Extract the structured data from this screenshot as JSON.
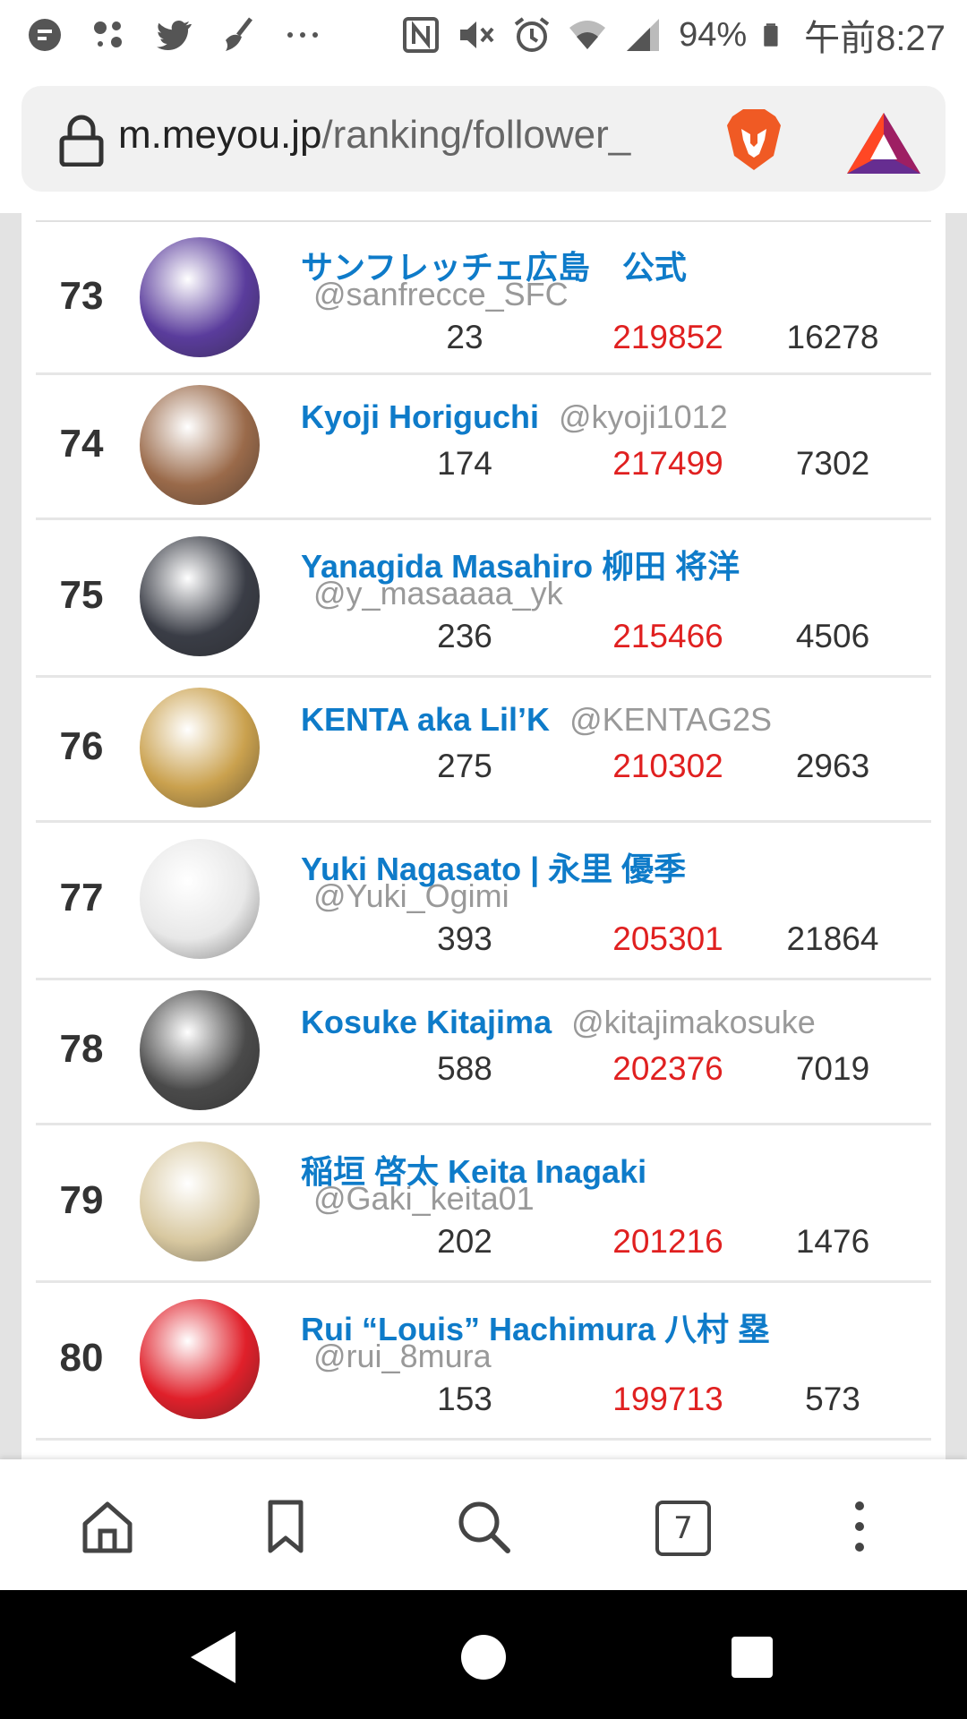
{
  "status_bar": {
    "battery": "94%",
    "time": "午前8:27",
    "icons": [
      "assistant-icon",
      "dots-app-icon",
      "twitter-icon",
      "broom-icon",
      "more-dots-icon",
      "nfc-icon",
      "mute-icon",
      "alarm-icon",
      "wifi-icon",
      "signal-icon",
      "battery-icon"
    ]
  },
  "browser": {
    "url_domain": "m.meyou.jp",
    "url_path": "/ranking/follower_",
    "icons": [
      "lock-icon",
      "brave-lion-icon",
      "bat-triangle-icon"
    ]
  },
  "rows": [
    {
      "rank": "73",
      "name": "サンフレッチェ広島　公式",
      "handle": "@sanfrecce_SFC",
      "n1": "23",
      "n2": "219852",
      "n3": "16278",
      "avatar_color": "#5a3c9c"
    },
    {
      "rank": "74",
      "name": "Kyoji Horiguchi",
      "handle": "@kyoji1012",
      "n1": "174",
      "n2": "217499",
      "n3": "7302",
      "avatar_color": "#9a6a4a"
    },
    {
      "rank": "75",
      "name": "Yanagida Masahiro 柳田 将洋",
      "handle": "@y_masaaaa_yk",
      "n1": "236",
      "n2": "215466",
      "n3": "4506",
      "avatar_color": "#3a3d46"
    },
    {
      "rank": "76",
      "name": "KENTA aka Lil’K",
      "handle": "@KENTAG2S",
      "n1": "275",
      "n2": "210302",
      "n3": "2963",
      "avatar_color": "#caa14e"
    },
    {
      "rank": "77",
      "name": "Yuki Nagasato | 永里 優季",
      "handle": "@Yuki_Ogimi",
      "n1": "393",
      "n2": "205301",
      "n3": "21864",
      "avatar_color": "#e8e8e8"
    },
    {
      "rank": "78",
      "name": "Kosuke Kitajima",
      "handle": "@kitajimakosuke",
      "n1": "588",
      "n2": "202376",
      "n3": "7019",
      "avatar_color": "#4a4a4a"
    },
    {
      "rank": "79",
      "name": "稲垣 啓太 Keita Inagaki",
      "handle": "@Gaki_keita01",
      "n1": "202",
      "n2": "201216",
      "n3": "1476",
      "avatar_color": "#d8c8a0"
    },
    {
      "rank": "80",
      "name": "Rui “Louis” Hachimura 八村 塁",
      "handle": "@rui_8mura",
      "n1": "153",
      "n2": "199713",
      "n3": "573",
      "avatar_color": "#e0202a"
    }
  ],
  "toolbar": {
    "tabs_count": "7",
    "icons": [
      "home-icon",
      "bookmark-icon",
      "search-icon",
      "tabs-icon",
      "menu-icon"
    ]
  },
  "nav": {
    "icons": [
      "back-icon",
      "home-circle-icon",
      "recents-icon"
    ]
  }
}
